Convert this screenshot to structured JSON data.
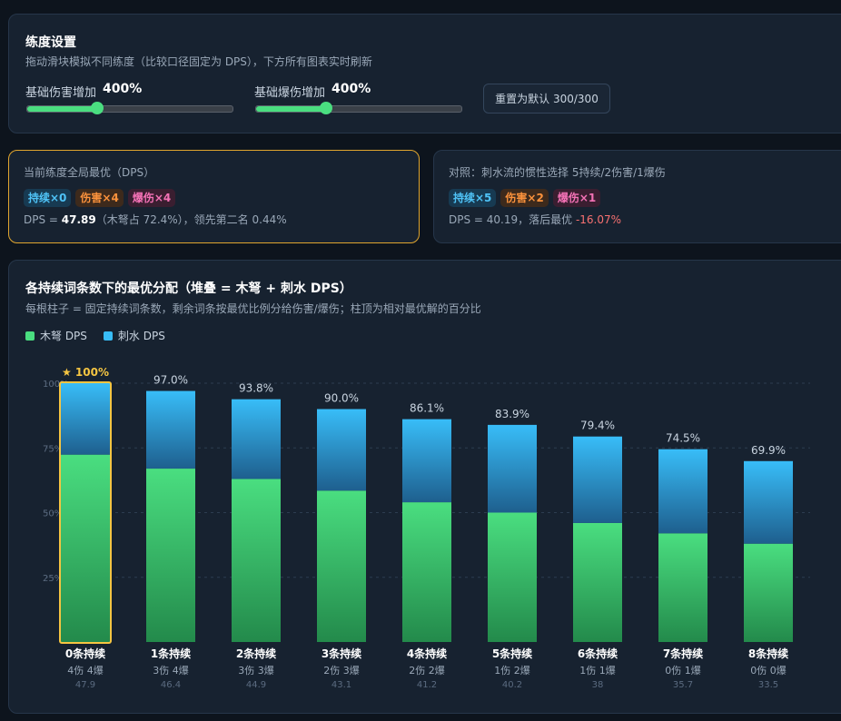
{
  "settings": {
    "title": "练度设置",
    "subtitle": "拖动滑块模拟不同练度（比较口径固定为 DPS），下方所有图表实时刷新",
    "slider1": {
      "label": "基础伤害增加",
      "value_text": "400%",
      "fraction": 0.34
    },
    "slider2": {
      "label": "基础爆伤增加",
      "value_text": "400%",
      "fraction": 0.34
    },
    "reset_label": "重置为默认 300/300"
  },
  "best": {
    "label": "当前练度全局最优（DPS）",
    "tags": [
      "持续×0",
      "伤害×4",
      "爆伤×4"
    ],
    "dps_prefix": "DPS = ",
    "dps_value": "47.89",
    "dps_suffix": "（木弩占 72.4%），领先第二名 0.44%"
  },
  "compare": {
    "label": "对照：刺水流的惯性选择 5持续/2伤害/1爆伤",
    "tags": [
      "持续×5",
      "伤害×2",
      "爆伤×1"
    ],
    "dps_text": "DPS = 40.19，落后最优 ",
    "diff": "-16.07%"
  },
  "chart_panel": {
    "title": "各持续词条数下的最优分配（堆叠 = 木弩 + 刺水 DPS）",
    "subtitle": "每根柱子 = 固定持续词条数，剩余词条按最优比例分给伤害/爆伤；柱顶为相对最优解的百分比",
    "legend": [
      "木弩 DPS",
      "刺水 DPS"
    ]
  },
  "colors": {
    "mushu": "#4ade80",
    "cishui": "#38bdf8",
    "highlight": "#f5c542"
  },
  "chart_data": {
    "type": "bar",
    "stacked": true,
    "categories": [
      "0条持续",
      "1条持续",
      "2条持续",
      "3条持续",
      "4条持续",
      "5条持续",
      "6条持续",
      "7条持续",
      "8条持续"
    ],
    "sub_labels": [
      "4伤 4爆",
      "3伤 4爆",
      "3伤 3爆",
      "2伤 3爆",
      "2伤 2爆",
      "1伤 2爆",
      "1伤 1爆",
      "0伤 1爆",
      "0伤 0爆"
    ],
    "totals": [
      "47.9",
      "46.4",
      "44.9",
      "43.1",
      "41.2",
      "40.2",
      "38",
      "35.7",
      "33.5"
    ],
    "top_labels": [
      "★ 100%",
      "97.0%",
      "93.8%",
      "90.0%",
      "86.1%",
      "83.9%",
      "79.4%",
      "74.5%",
      "69.9%"
    ],
    "series": [
      {
        "name": "木弩 DPS",
        "values": [
          72.4,
          67.0,
          63.0,
          58.5,
          54.0,
          50.0,
          46.0,
          42.0,
          38.0
        ]
      },
      {
        "name": "刺水 DPS",
        "values": [
          27.6,
          30.0,
          30.8,
          31.5,
          32.1,
          33.9,
          33.4,
          32.5,
          31.9
        ]
      }
    ],
    "highlight_index": 0,
    "ylim": [
      0,
      100
    ],
    "yticks": [
      "25%",
      "50%",
      "75%",
      "100%"
    ],
    "grid": true,
    "legend_position": "top-left"
  }
}
